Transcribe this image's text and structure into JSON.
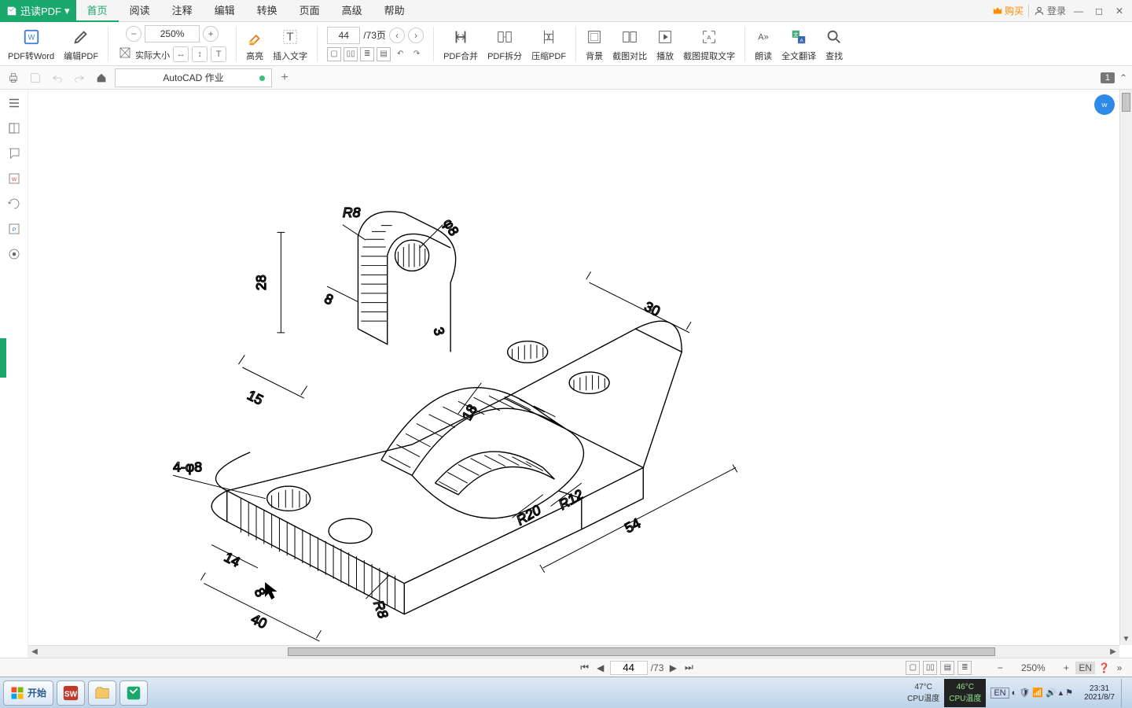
{
  "app": {
    "name": "迅读PDF",
    "dropdown": "▾"
  },
  "menu": [
    "首页",
    "阅读",
    "注释",
    "编辑",
    "转换",
    "页面",
    "高级",
    "帮助"
  ],
  "menu_active_index": 0,
  "title_right": {
    "buy": "购买",
    "login": "登录"
  },
  "ribbon": {
    "pdf_to_word": "PDF转Word",
    "edit_pdf": "编辑PDF",
    "zoom_value": "250%",
    "real_size": "实际大小",
    "highlight": "高亮",
    "insert_text": "插入文字",
    "page_value": "44",
    "page_total": "/73页",
    "merge": "PDF合并",
    "split": "PDF拆分",
    "compress": "压缩PDF",
    "bg": "背景",
    "compare": "截图对比",
    "play": "播放",
    "ocr": "截图提取文字",
    "read": "朗读",
    "translate": "全文翻译",
    "find": "查找"
  },
  "filebar": {
    "tab_name": "AutoCAD 作业",
    "right_badge": "1"
  },
  "statusbar": {
    "page": "44",
    "total": "/73",
    "zoom": "250%",
    "lang": "EN"
  },
  "drawing": {
    "dims": {
      "R8a": "R8",
      "phi8": "φ8",
      "v28": "28",
      "v8": "8",
      "v3": "3",
      "v15": "15",
      "v18": "18",
      "v30": "30",
      "v54": "54",
      "hole": "4-φ8",
      "v14": "14",
      "another8": "8",
      "v40": "40",
      "R8b": "R8",
      "R20": "R20",
      "R12": "R12"
    }
  },
  "taskbar": {
    "start": "开始",
    "temp1": {
      "val": "47°C",
      "lbl": "CPU温度"
    },
    "temp2": {
      "val": "46°C",
      "lbl": "CPU温度"
    },
    "lang": "EN",
    "time": "23:31",
    "date": "2021/8/7"
  }
}
